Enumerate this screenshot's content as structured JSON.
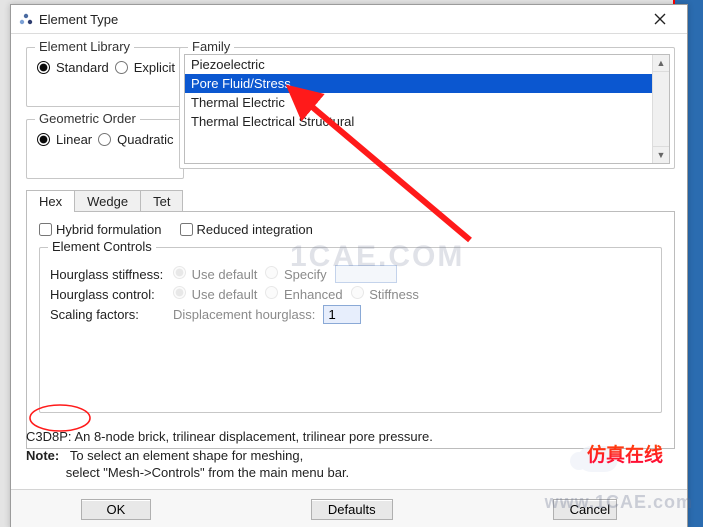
{
  "window": {
    "title": "Element Type"
  },
  "element_library": {
    "legend": "Element Library",
    "standard": "Standard",
    "explicit": "Explicit",
    "selected": "standard"
  },
  "geometric_order": {
    "legend": "Geometric Order",
    "linear": "Linear",
    "quadratic": "Quadratic",
    "selected": "linear"
  },
  "family": {
    "legend": "Family",
    "options": [
      "Piezoelectric",
      "Pore Fluid/Stress",
      "Thermal Electric",
      "Thermal Electrical Structural"
    ],
    "selected": "Pore Fluid/Stress"
  },
  "tabs": {
    "items": [
      "Hex",
      "Wedge",
      "Tet"
    ],
    "active": "Hex"
  },
  "hex": {
    "hybrid": "Hybrid formulation",
    "reduced": "Reduced integration"
  },
  "element_controls": {
    "legend": "Element Controls",
    "hourglass_stiffness_label": "Hourglass stiffness:",
    "use_default": "Use default",
    "specify": "Specify",
    "hourglass_control_label": "Hourglass control:",
    "enhanced": "Enhanced",
    "stiffness": "Stiffness",
    "scaling_factors_label": "Scaling factors:",
    "disp_hourglass_label": "Displacement hourglass:",
    "disp_hourglass_value": "1"
  },
  "desc": {
    "code": "C3D8P:",
    "text": "An 8-node brick, trilinear displacement, trilinear pore pressure."
  },
  "note": {
    "label": "Note:",
    "line1": "To select an element shape for meshing,",
    "line2": "select \"Mesh->Controls\" from the main menu bar."
  },
  "buttons": {
    "ok": "OK",
    "defaults": "Defaults",
    "cancel": "Cancel"
  },
  "overlays": {
    "watermark1": "1CAE.COM",
    "watermark2": "www.1CAE.com",
    "cntxt": "仿真在线"
  }
}
